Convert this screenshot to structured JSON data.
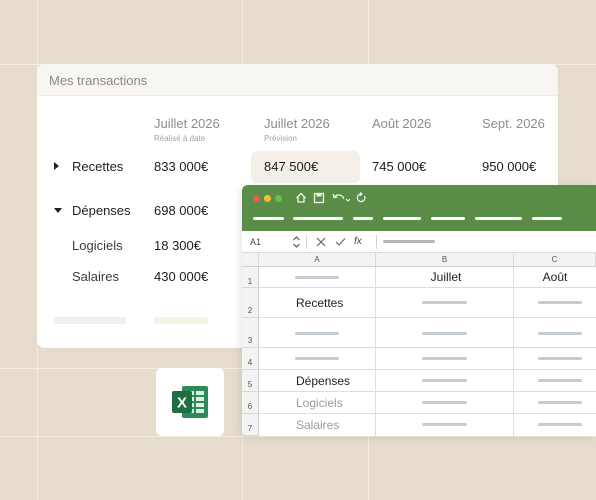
{
  "transactions": {
    "title": "Mes transactions",
    "columns": [
      {
        "month": "Juillet 2026",
        "subtitle": "Réalisé à date"
      },
      {
        "month": "Juillet 2026",
        "subtitle": "Prévision"
      },
      {
        "month": "Août 2026",
        "subtitle": ""
      },
      {
        "month": "Sept. 2026",
        "subtitle": ""
      }
    ],
    "rows": [
      {
        "label": "Recettes",
        "expander": "collapsed",
        "values": [
          "833 000€",
          "847 500€",
          "745 000€",
          "950 000€"
        ]
      },
      {
        "label": "Dépenses",
        "expander": "expanded",
        "values": [
          "698 000€"
        ]
      },
      {
        "label": "Logiciels",
        "values": [
          "18 300€"
        ]
      },
      {
        "label": "Salaires",
        "values": [
          "430 000€"
        ]
      }
    ]
  },
  "excel_tile": {
    "icon": "excel-logo-icon",
    "brand_color": "#1d6f42",
    "letter": "X"
  },
  "spreadsheet": {
    "header_color": "#5a8d47",
    "cell_ref": "A1",
    "fx_label": "fx",
    "columns": [
      "A",
      "B",
      "C"
    ],
    "row_numbers": [
      "1",
      "2",
      "3",
      "4",
      "5",
      "6",
      "7"
    ],
    "header_row": [
      "",
      "Juillet",
      "Août"
    ],
    "cells": {
      "recettes": "Recettes",
      "depenses": "Dépenses",
      "logiciels": "Logiciels",
      "salaires": "Salaires"
    }
  }
}
